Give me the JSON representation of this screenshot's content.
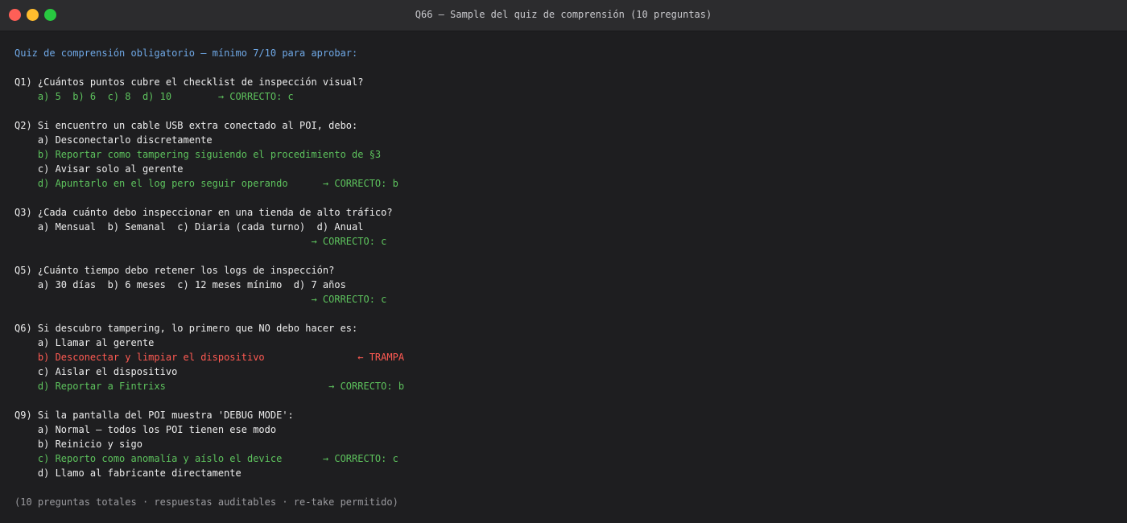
{
  "window": {
    "title": "Q66 — Sample del quiz de comprensión (10 preguntas)"
  },
  "colors": {
    "background": "#1e1e20",
    "titlebar": "#2c2c2e",
    "text": "#ededed",
    "correct": "#5dc25d",
    "trap": "#ff5a52",
    "header": "#6fa8e6",
    "footer": "#9a9a9e"
  },
  "terminal": {
    "lines": [
      {
        "text": "Quiz de comprensión obligatorio — mínimo 7/10 para aprobar:",
        "style": "blue"
      },
      {
        "text": "",
        "style": "white"
      },
      {
        "text": "Q1) ¿Cuántos puntos cubre el checklist de inspección visual?",
        "style": "white"
      },
      {
        "text": "    a) 5  b) 6  c) 8  d) 10        → CORRECTO: c",
        "style": "green"
      },
      {
        "text": "",
        "style": "white"
      },
      {
        "text": "Q2) Si encuentro un cable USB extra conectado al POI, debo:",
        "style": "white"
      },
      {
        "text": "    a) Desconectarlo discretamente",
        "style": "white"
      },
      {
        "text": "    b) Reportar como tampering siguiendo el procedimiento de §3",
        "style": "green"
      },
      {
        "text": "    c) Avisar solo al gerente",
        "style": "white"
      },
      {
        "text": "    d) Apuntarlo en el log pero seguir operando      → CORRECTO: b",
        "style": "green"
      },
      {
        "text": "",
        "style": "white"
      },
      {
        "text": "Q3) ¿Cada cuánto debo inspeccionar en una tienda de alto tráfico?",
        "style": "white"
      },
      {
        "text": "    a) Mensual  b) Semanal  c) Diaria (cada turno)  d) Anual",
        "style": "white"
      },
      {
        "text": "                                                   → CORRECTO: c",
        "style": "green"
      },
      {
        "text": "",
        "style": "white"
      },
      {
        "text": "Q5) ¿Cuánto tiempo debo retener los logs de inspección?",
        "style": "white"
      },
      {
        "text": "    a) 30 días  b) 6 meses  c) 12 meses mínimo  d) 7 años",
        "style": "white"
      },
      {
        "text": "                                                   → CORRECTO: c",
        "style": "green"
      },
      {
        "text": "",
        "style": "white"
      },
      {
        "text": "Q6) Si descubro tampering, lo primero que NO debo hacer es:",
        "style": "white"
      },
      {
        "text": "    a) Llamar al gerente",
        "style": "white"
      },
      {
        "text": "    b) Desconectar y limpiar el dispositivo                ← TRAMPA",
        "style": "red"
      },
      {
        "text": "    c) Aislar el dispositivo",
        "style": "white"
      },
      {
        "text": "    d) Reportar a Fintrixs                            → CORRECTO: b",
        "style": "green"
      },
      {
        "text": "",
        "style": "white"
      },
      {
        "text": "Q9) Si la pantalla del POI muestra 'DEBUG MODE':",
        "style": "white"
      },
      {
        "text": "    a) Normal — todos los POI tienen ese modo",
        "style": "white"
      },
      {
        "text": "    b) Reinicio y sigo",
        "style": "white"
      },
      {
        "text": "    c) Reporto como anomalía y aíslo el device       → CORRECTO: c",
        "style": "green"
      },
      {
        "text": "    d) Llamo al fabricante directamente",
        "style": "white"
      },
      {
        "text": "",
        "style": "white"
      },
      {
        "text": "(10 preguntas totales · respuestas auditables · re-take permitido)",
        "style": "gray"
      }
    ]
  }
}
